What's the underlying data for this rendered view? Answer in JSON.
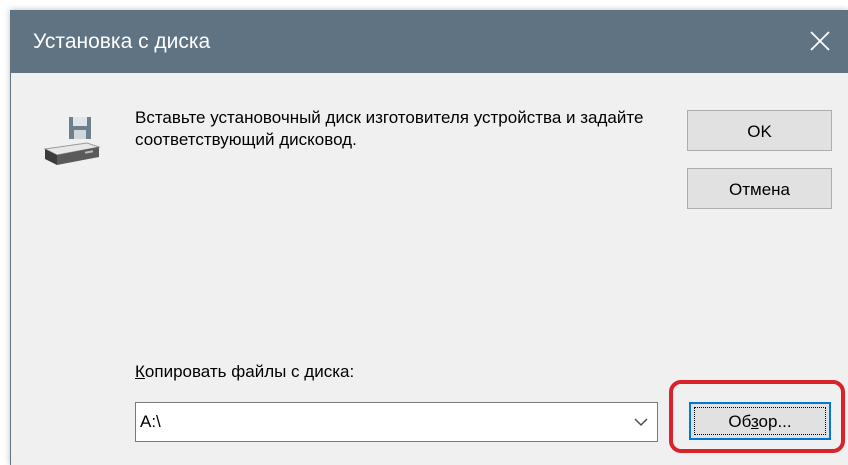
{
  "window": {
    "title": "Установка с диска",
    "close_icon": "close-icon"
  },
  "body": {
    "icon": "floppy-drive-icon",
    "instruction": "Вставьте установочный диск изготовителя устройства и задайте соответствующий дисковод."
  },
  "buttons": {
    "ok_label": "OK",
    "cancel_label": "Отмена",
    "browse_label_pre": "Об",
    "browse_label_mnemonic": "з",
    "browse_label_post": "ор..."
  },
  "copy": {
    "label_mnemonic": "К",
    "label_rest": "опировать файлы с диска:",
    "path_value": "A:\\",
    "dropdown_icon": "chevron-down-icon"
  },
  "colors": {
    "titlebar": "#5f7382",
    "dialog_background": "#f0f0f0",
    "highlight_ring": "#d8232a",
    "focus_border": "#0078d7"
  }
}
